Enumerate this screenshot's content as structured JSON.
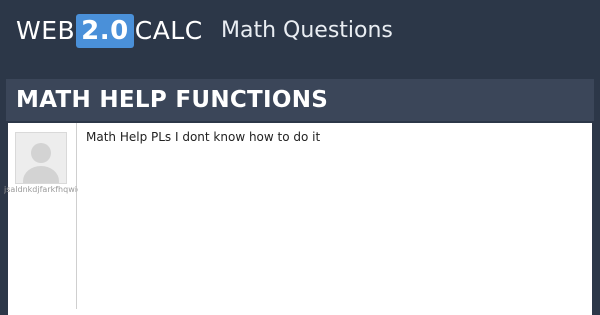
{
  "header": {
    "logo": {
      "prefix": "WEB",
      "badge": "2.0",
      "suffix": "CALC"
    },
    "section_title": "Math Questions"
  },
  "question": {
    "title": "MATH HELP FUNCTIONS",
    "body": "Math Help PLs I dont know how to do it",
    "author": {
      "username": "jsaldnkdjfarkfhqwio3r",
      "avatar_icon": "default-user-avatar-icon"
    }
  },
  "colors": {
    "background": "#2c3748",
    "banner": "#3b4659",
    "logo_badge": "#4a90d9",
    "content_background": "#ffffff"
  }
}
